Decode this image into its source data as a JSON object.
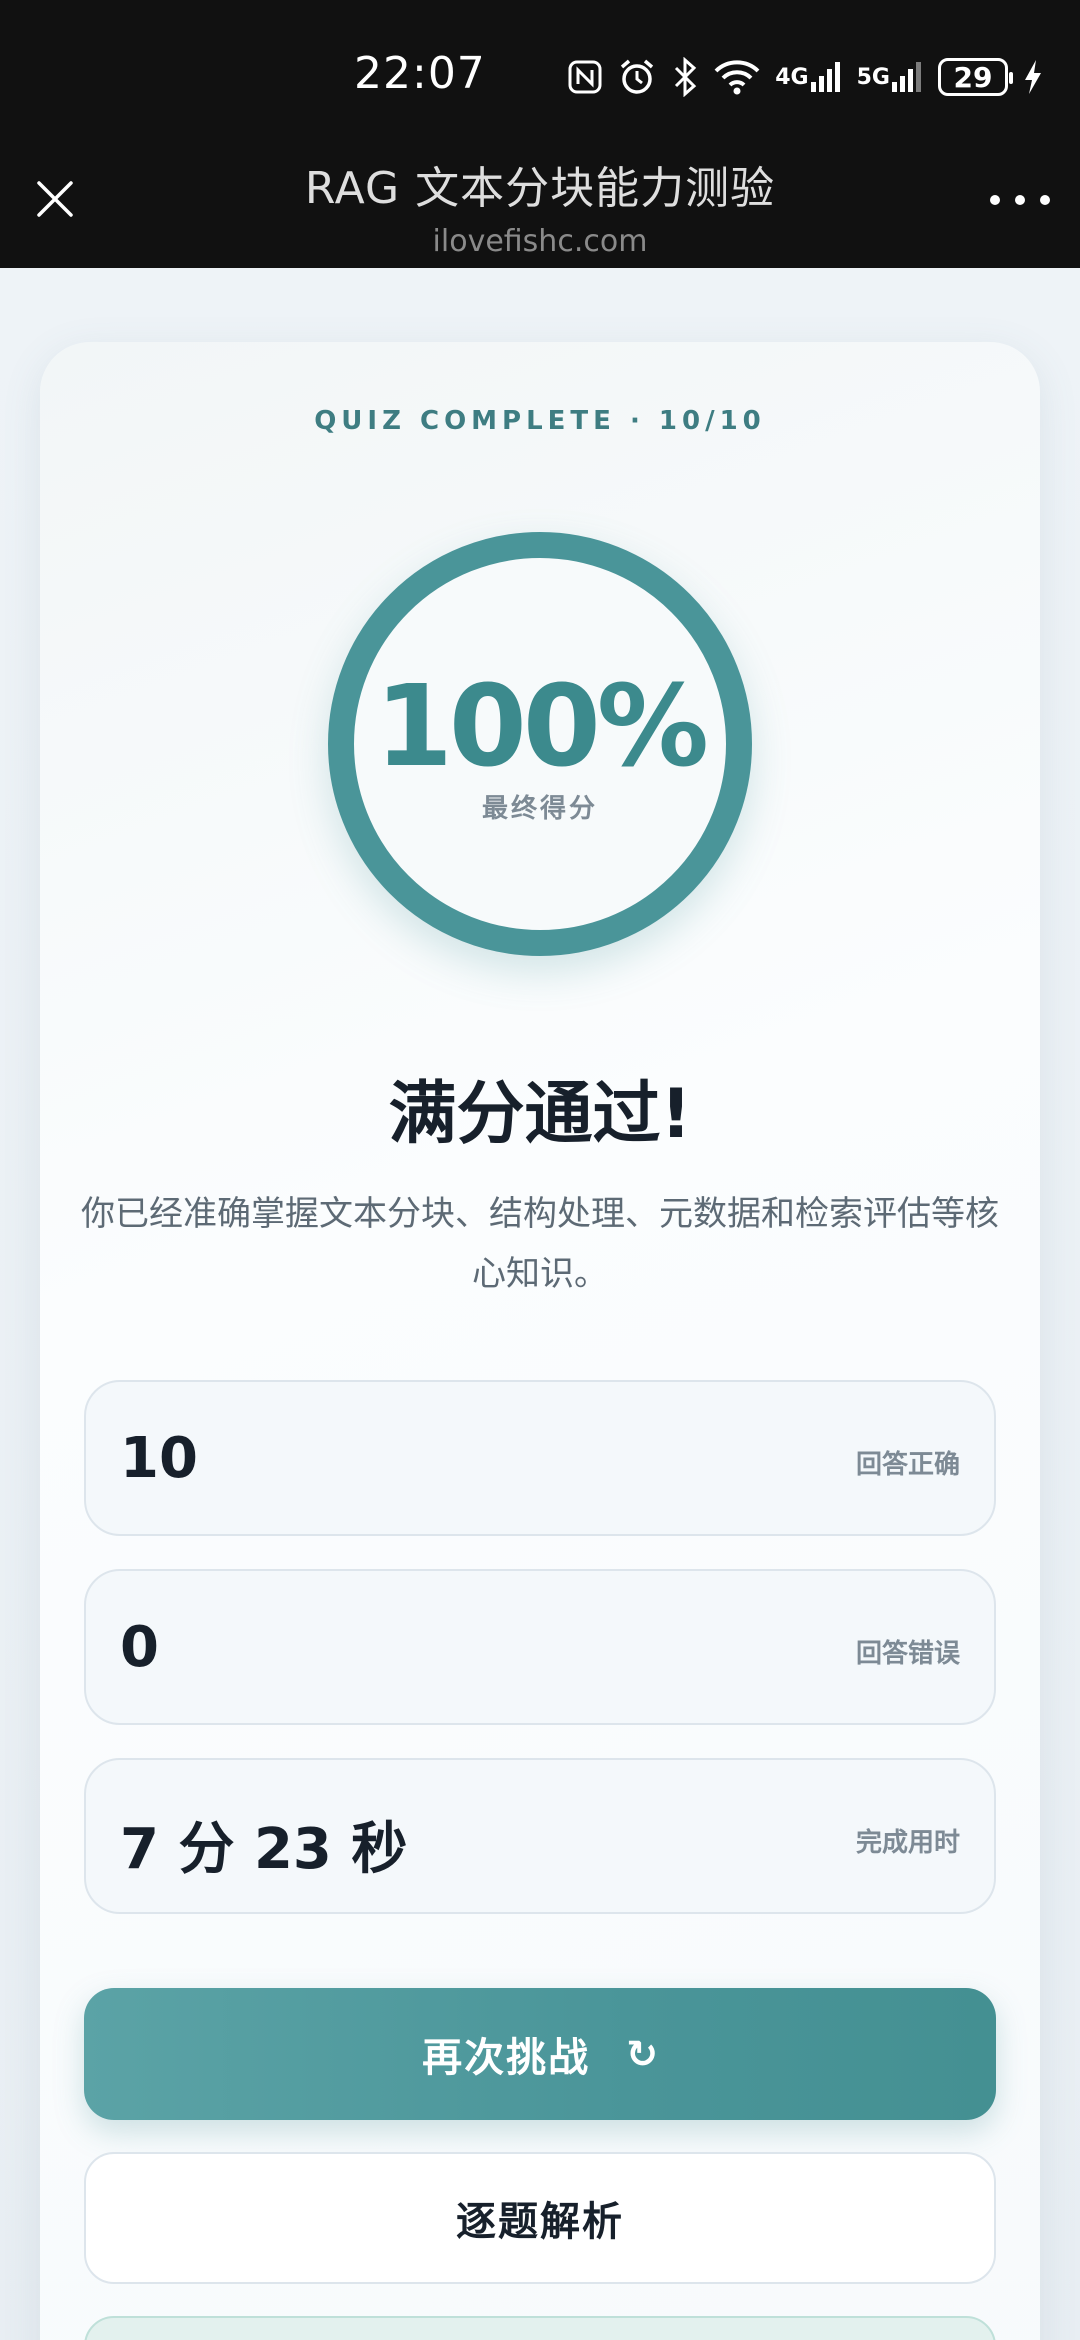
{
  "status_bar": {
    "time": "22:07",
    "icons": [
      "nfc-icon",
      "alarm-icon",
      "bluetooth-icon",
      "wifi-icon",
      "signal-4g-icon",
      "signal-5g-icon"
    ],
    "net_4g": "4G",
    "net_5g": "5G",
    "battery": "29"
  },
  "title_bar": {
    "title": "RAG 文本分块能力测验",
    "domain": "ilovefishc.com"
  },
  "result": {
    "quiz_label": "QUIZ COMPLETE · 10/10",
    "score": "100%",
    "score_label": "最终得分",
    "headline": "满分通过!",
    "description": "你已经准确掌握文本分块、结构处理、元数据和检索评估等核心知识。"
  },
  "stats": [
    {
      "value": "10",
      "label": "回答正确"
    },
    {
      "value": "0",
      "label": "回答错误"
    },
    {
      "value": "7 分 23 秒",
      "label": "完成用时"
    }
  ],
  "actions": {
    "retry_label": "再次挑战",
    "retry_icon": "↻",
    "review_label": "逐题解析"
  },
  "colors": {
    "accent": "#4a9599",
    "text_dark": "#17202b",
    "text_muted": "#7d8a95"
  }
}
